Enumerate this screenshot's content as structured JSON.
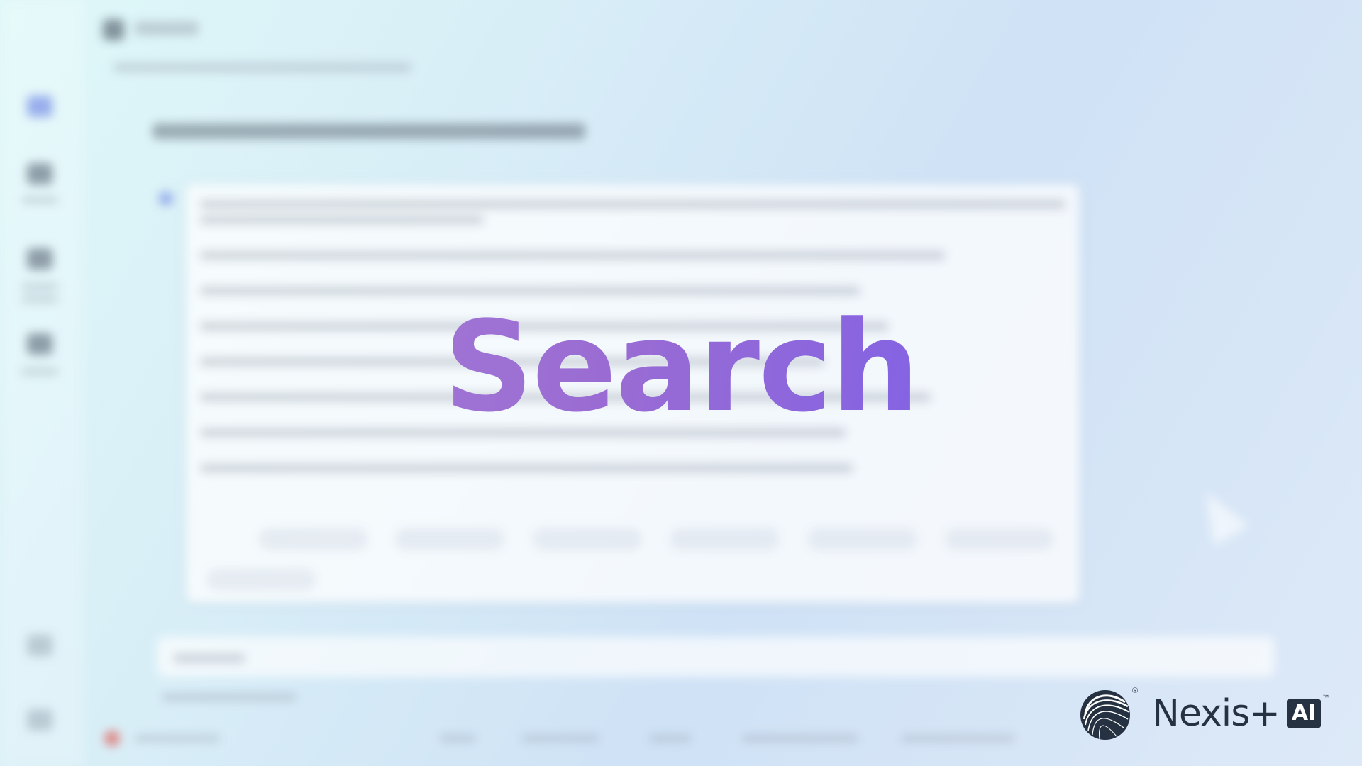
{
  "overlay": {
    "title": "Search"
  },
  "brand": {
    "name": "Nexis+",
    "badge": "AI",
    "registered": "®",
    "trademark": "™"
  },
  "icons": {
    "logo": "nexis-swirl-logo-icon",
    "cursor": "mouse-pointer-icon"
  },
  "colors": {
    "title_gradient_start": "#ad86d6",
    "title_gradient_end": "#7d60e8",
    "brand_dark": "#263241"
  }
}
